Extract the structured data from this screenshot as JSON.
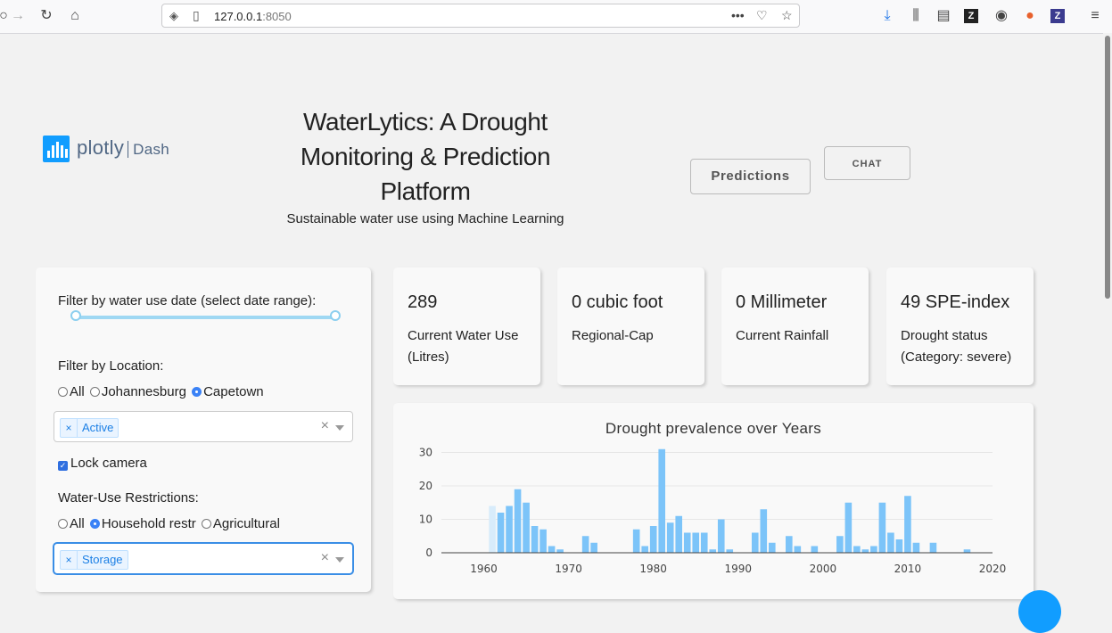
{
  "browser": {
    "url_host": "127.0.0.1",
    "url_port": ":8050",
    "url_more": "•••"
  },
  "logo": {
    "word": "plotly",
    "product": "Dash"
  },
  "header": {
    "title": "WaterLytics: A Drought Monitoring & Prediction Platform",
    "subtitle": "Sustainable water use using Machine Learning",
    "predictions_label": "Predictions",
    "chat_label": "CHAT"
  },
  "filters": {
    "date_label": "Filter by water use date (select date range):",
    "location_label": "Filter by Location:",
    "location_options": [
      "All",
      "Johannesburg",
      "Capetown"
    ],
    "location_selected": "Capetown",
    "location_tag": "Active",
    "lock_camera_label": "Lock camera",
    "lock_camera_checked": true,
    "restrictions_label": "Water-Use Restrictions:",
    "restriction_options": [
      "All",
      "Household restr",
      "Agricultural"
    ],
    "restriction_selected": "Household restr",
    "restriction_tag": "Storage",
    "clear_glyph": "×"
  },
  "stats": [
    {
      "value": "289",
      "label": "Current Water Use (Litres)"
    },
    {
      "value": "0 cubic foot",
      "label": "Regional-Cap"
    },
    {
      "value": "0 Millimeter",
      "label": "Current Rainfall"
    },
    {
      "value": "49 SPE-index",
      "label": "Drought status (Category: severe)"
    }
  ],
  "colors": {
    "bar": "#7cc4f9",
    "bar_faded": "#d8ecfb",
    "accent": "#119dff"
  },
  "chart_data": {
    "type": "bar",
    "title": "Drought prevalence over Years",
    "xlabel": "",
    "ylabel": "",
    "xlim": [
      1955,
      2020
    ],
    "ylim": [
      0,
      32
    ],
    "xticks": [
      1960,
      1970,
      1980,
      1990,
      2000,
      2010,
      2020
    ],
    "yticks": [
      0,
      10,
      20,
      30
    ],
    "grid": true,
    "x": [
      1961,
      1962,
      1963,
      1964,
      1965,
      1966,
      1967,
      1968,
      1969,
      1972,
      1973,
      1978,
      1979,
      1980,
      1981,
      1982,
      1983,
      1984,
      1985,
      1986,
      1987,
      1988,
      1989,
      1992,
      1993,
      1994,
      1996,
      1997,
      1999,
      2002,
      2003,
      2004,
      2005,
      2006,
      2007,
      2008,
      2009,
      2010,
      2011,
      2013,
      2017
    ],
    "values": [
      14,
      12,
      14,
      19,
      15,
      8,
      7,
      2,
      1,
      5,
      3,
      7,
      2,
      8,
      31,
      9,
      11,
      6,
      6,
      6,
      1,
      10,
      1,
      6,
      13,
      3,
      5,
      2,
      2,
      5,
      15,
      2,
      1,
      2,
      15,
      6,
      4,
      17,
      3,
      3,
      1
    ],
    "faded_x": [
      1961
    ]
  }
}
